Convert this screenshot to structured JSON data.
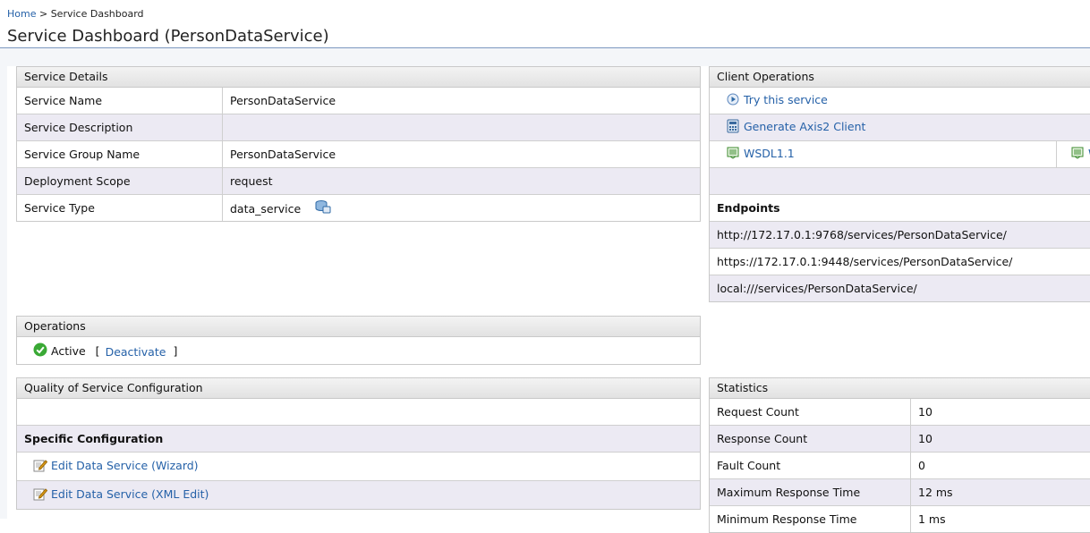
{
  "breadcrumb": {
    "home": "Home",
    "separator": ">",
    "current": "Service Dashboard"
  },
  "page_title": "Service Dashboard (PersonDataService)",
  "service_details": {
    "header": "Service Details",
    "rows": [
      {
        "label": "Service Name",
        "value": "PersonDataService"
      },
      {
        "label": "Service Description",
        "value": ""
      },
      {
        "label": "Service Group Name",
        "value": "PersonDataService"
      },
      {
        "label": "Deployment Scope",
        "value": "request"
      },
      {
        "label": "Service Type",
        "value": "data_service"
      }
    ]
  },
  "client_operations": {
    "header": "Client Operations",
    "try_service": "Try this service",
    "generate_client": "Generate Axis2 Client",
    "wsdl11": "WSDL1.1",
    "wsdl_partial": "W"
  },
  "endpoints": {
    "header": "Endpoints",
    "items": [
      "http://172.17.0.1:9768/services/PersonDataService/",
      "https://172.17.0.1:9448/services/PersonDataService/",
      "local:///services/PersonDataService/"
    ]
  },
  "operations": {
    "header": "Operations",
    "status": "Active",
    "bracket_open": "[",
    "deactivate": "Deactivate",
    "bracket_close": "]"
  },
  "qos": {
    "header": "Quality of Service Configuration",
    "specific_header": "Specific Configuration",
    "edit_wizard": "Edit Data Service (Wizard)",
    "edit_xml": "Edit Data Service (XML Edit)"
  },
  "statistics": {
    "header": "Statistics",
    "rows": [
      {
        "label": "Request Count",
        "value": "10"
      },
      {
        "label": "Response Count",
        "value": "10"
      },
      {
        "label": "Fault Count",
        "value": "0"
      },
      {
        "label": "Maximum Response Time",
        "value": "12 ms"
      },
      {
        "label": "Minimum Response Time",
        "value": "1 ms"
      }
    ]
  },
  "colors": {
    "link": "#2561a8",
    "alt_row": "#eceaf3",
    "active_green": "#3aa935"
  }
}
